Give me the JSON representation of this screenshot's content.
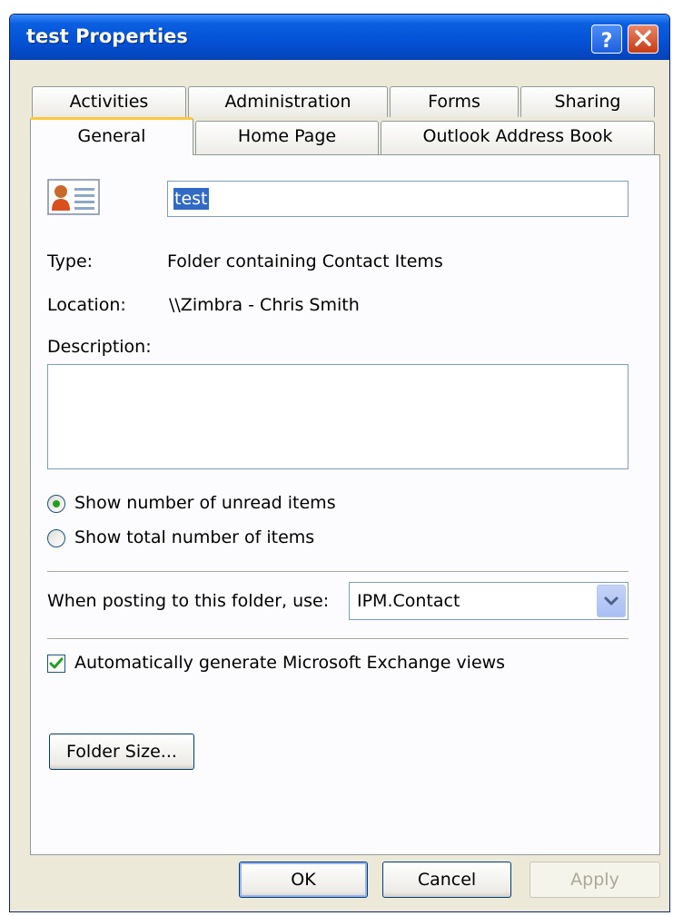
{
  "window": {
    "title": "test Properties",
    "help_icon": "question-mark-icon",
    "close_icon": "close-x-icon"
  },
  "tabs": {
    "row1": [
      {
        "label": "Activities"
      },
      {
        "label": "Administration"
      },
      {
        "label": "Forms"
      },
      {
        "label": "Sharing"
      }
    ],
    "row2": [
      {
        "label": "General",
        "active": true
      },
      {
        "label": "Home Page"
      },
      {
        "label": "Outlook Address Book"
      }
    ]
  },
  "general": {
    "folder_icon": "contact-card-icon",
    "name_value": "test",
    "type_label": "Type:",
    "type_value": "Folder containing Contact Items",
    "location_label": "Location:",
    "location_value": "\\\\Zimbra - Chris Smith",
    "description_label": "Description:",
    "description_value": "",
    "radio_unread_label": "Show number of unread items",
    "radio_total_label": "Show total number of items",
    "radio_selected": "unread",
    "posting_label": "When posting to this folder, use:",
    "posting_value": "IPM.Contact",
    "auto_views_label": "Automatically generate Microsoft Exchange views",
    "auto_views_checked": true,
    "folder_size_label": "Folder Size..."
  },
  "buttons": {
    "ok": "OK",
    "cancel": "Cancel",
    "apply": "Apply"
  },
  "colors": {
    "titlebar": "#0451D6",
    "dialog_bg": "#ECE9D8",
    "active_tab_accent": "#FFC73C",
    "radio_dot": "#21A121",
    "check_mark": "#21A121"
  }
}
